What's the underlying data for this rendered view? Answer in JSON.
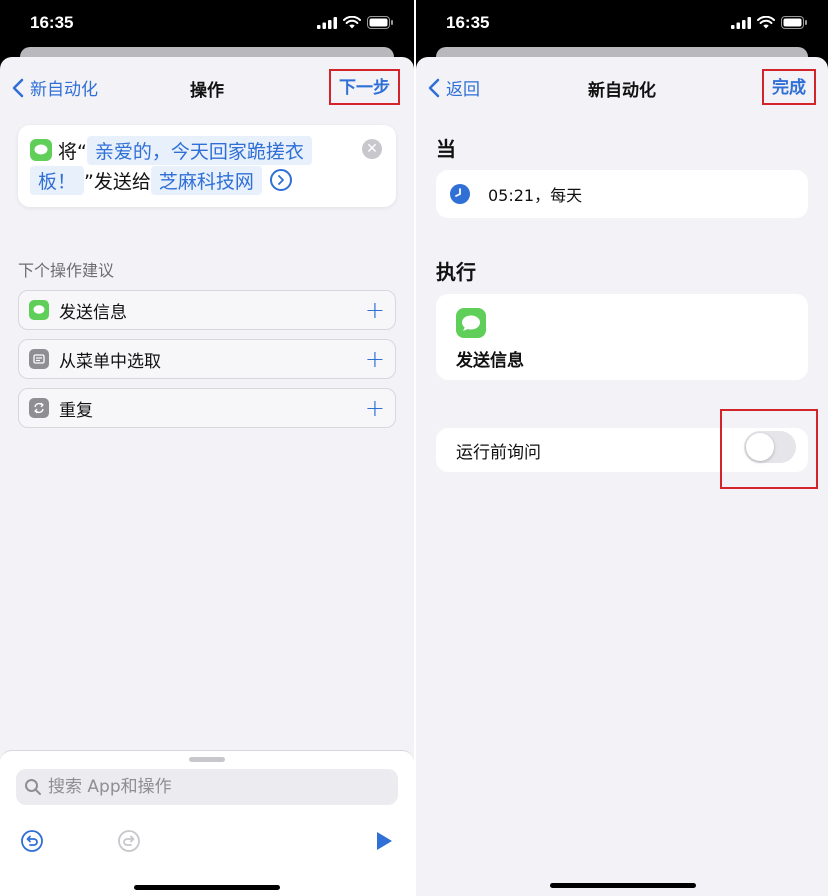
{
  "left": {
    "status": {
      "time": "16:35"
    },
    "nav": {
      "back_label": "新自动化",
      "title": "操作",
      "action_label": "下一步"
    },
    "action_card": {
      "prefix": "将“",
      "message_token_line1": "亲爱的，今天回家跪搓衣",
      "message_token_line2": "板！",
      "middle": "”发送给",
      "recipient_token": "芝麻科技网"
    },
    "suggestions_header": "下个操作建议",
    "suggestions": [
      {
        "label": "发送信息",
        "icon": "messages-icon"
      },
      {
        "label": "从菜单中选取",
        "icon": "menu-icon"
      },
      {
        "label": "重复",
        "icon": "repeat-icon"
      }
    ],
    "search": {
      "placeholder": "搜索 App和操作"
    }
  },
  "right": {
    "status": {
      "time": "16:35"
    },
    "nav": {
      "back_label": "返回",
      "title": "新自动化",
      "action_label": "完成"
    },
    "when_heading": "当",
    "trigger": {
      "text": "05:21，每天",
      "icon": "clock-icon"
    },
    "do_heading": "执行",
    "action": {
      "label": "发送信息",
      "icon": "messages-icon"
    },
    "ask_before_running": {
      "label": "运行前询问",
      "enabled": false
    }
  },
  "colors": {
    "accent": "#2f6fd6",
    "highlight": "#d2242a",
    "messages_green": "#5fcf5a"
  }
}
